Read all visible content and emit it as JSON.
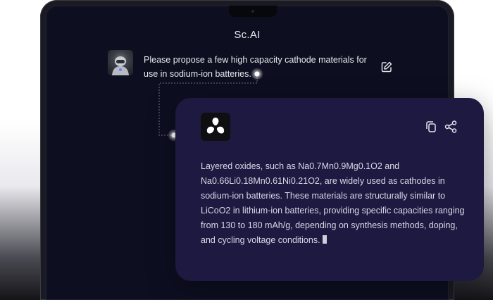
{
  "app": {
    "title": "Sc.AI"
  },
  "chat": {
    "prompt": "Please propose a few high capacity cathode materials for use in sodium-ion batteries.",
    "response": "Layered oxides, such as Na0.7Mn0.9Mg0.1O2 and Na0.66Li0.18Mn0.61Ni0.21O2, are widely used as cathodes in sodium-ion batteries. These materials are structurally similar to LiCoO2 in lithium-ion batteries, providing specific capacities ranging from 130 to 180 mAh/g, depending on synthesis methods, doping, and cycling voltage conditions."
  },
  "icons": {
    "edit": "edit-icon",
    "copy": "copy-icon",
    "share": "share-icon",
    "assistant_logo": "three-blob-logo"
  },
  "colors": {
    "screen_bg": "#0d0f21",
    "card_bg": "#1d1941",
    "text": "#e6e7ef"
  }
}
